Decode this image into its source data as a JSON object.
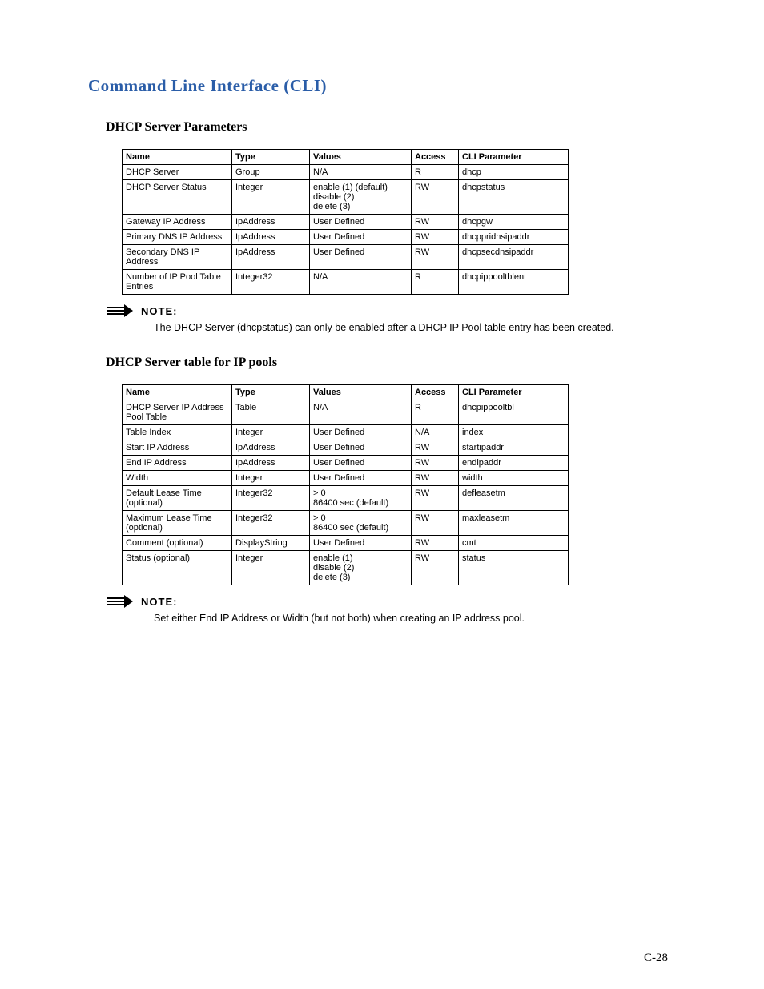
{
  "section_title": "Command Line Interface (CLI)",
  "page_number": "C-28",
  "table_headers": {
    "name": "Name",
    "type": "Type",
    "values": "Values",
    "access": "Access",
    "cli": "CLI Parameter"
  },
  "dhcp_params": {
    "title": "DHCP Server Parameters",
    "rows": [
      {
        "name": "DHCP Server",
        "type": "Group",
        "values": "N/A",
        "access": "R",
        "cli": "dhcp"
      },
      {
        "name": "DHCP Server Status",
        "type": "Integer",
        "values": "enable (1) (default)\ndisable (2)\ndelete (3)",
        "access": "RW",
        "cli": "dhcpstatus"
      },
      {
        "name": "Gateway IP Address",
        "type": "IpAddress",
        "values": "User Defined",
        "access": "RW",
        "cli": "dhcpgw"
      },
      {
        "name": "Primary DNS IP Address",
        "type": "IpAddress",
        "values": "User Defined",
        "access": "RW",
        "cli": "dhcppridnsipaddr"
      },
      {
        "name": "Secondary DNS IP Address",
        "type": "IpAddress",
        "values": "User Defined",
        "access": "RW",
        "cli": "dhcpsecdnsipaddr"
      },
      {
        "name": "Number of IP Pool Table Entries",
        "type": "Integer32",
        "values": "N/A",
        "access": "R",
        "cli": "dhcpippooltblent"
      }
    ]
  },
  "note1": {
    "label": "NOTE:",
    "text": "The DHCP Server (dhcpstatus) can only be enabled after a DHCP IP Pool table entry has been created."
  },
  "ip_pools": {
    "title": "DHCP Server table for IP pools",
    "rows": [
      {
        "name": "DHCP Server IP Address Pool Table",
        "type": "Table",
        "values": "N/A",
        "access": "R",
        "cli": "dhcpippooltbl"
      },
      {
        "name": "Table Index",
        "type": "Integer",
        "values": "User Defined",
        "access": "N/A",
        "cli": "index"
      },
      {
        "name": "Start IP Address",
        "type": "IpAddress",
        "values": "User Defined",
        "access": "RW",
        "cli": "startipaddr"
      },
      {
        "name": "End IP Address",
        "type": "IpAddress",
        "values": "User Defined",
        "access": "RW",
        "cli": "endipaddr"
      },
      {
        "name": "Width",
        "type": "Integer",
        "values": "User Defined",
        "access": "RW",
        "cli": "width"
      },
      {
        "name": "Default Lease Time (optional)",
        "type": "Integer32",
        "values": "> 0\n86400 sec (default)",
        "access": "RW",
        "cli": "defleasetm"
      },
      {
        "name": "Maximum Lease Time (optional)",
        "type": "Integer32",
        "values": "> 0\n86400 sec (default)",
        "access": "RW",
        "cli": "maxleasetm"
      },
      {
        "name": "Comment (optional)",
        "type": "DisplayString",
        "values": "User Defined",
        "access": "RW",
        "cli": "cmt"
      },
      {
        "name": "Status (optional)",
        "type": "Integer",
        "values": "enable (1)\ndisable (2)\ndelete (3)",
        "access": "RW",
        "cli": "status"
      }
    ]
  },
  "note2": {
    "label": "NOTE:",
    "text": "Set either End IP Address or Width (but not both) when creating an IP address pool."
  }
}
